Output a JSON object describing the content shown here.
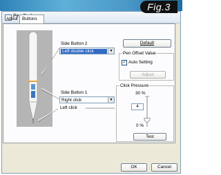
{
  "window": {
    "title": "Pen Pad",
    "badge": "Fig.3"
  },
  "tabs": [
    {
      "label": "About",
      "active": false
    },
    {
      "label": "Buttons",
      "active": true
    }
  ],
  "side_button_2": {
    "label": "Side Button 2",
    "value": "Left double click"
  },
  "side_button_1": {
    "label": "Side Button 1",
    "value": "Right click"
  },
  "tip_label": "Left click",
  "default_button": "Default",
  "pen_offset": {
    "title": "Pen Offset Value",
    "auto_setting_label": "Auto Setting",
    "auto_setting_checked": "✓",
    "adjust_button": "Adjust"
  },
  "click_pressure": {
    "title": "Click Pressure",
    "top_label": "30 %",
    "current_value": "4",
    "bottom_label": "0 %",
    "level_fraction": 0.13,
    "test_button": "Test"
  },
  "footer": {
    "ok_button": "OK",
    "cancel_button": "Cancel"
  },
  "colors": {
    "selection": "#316ac5",
    "pen_panel": "#b5b5b5",
    "pen_accent_orange": "#e8a33a",
    "pen_accent_blue": "#3a86c8"
  }
}
